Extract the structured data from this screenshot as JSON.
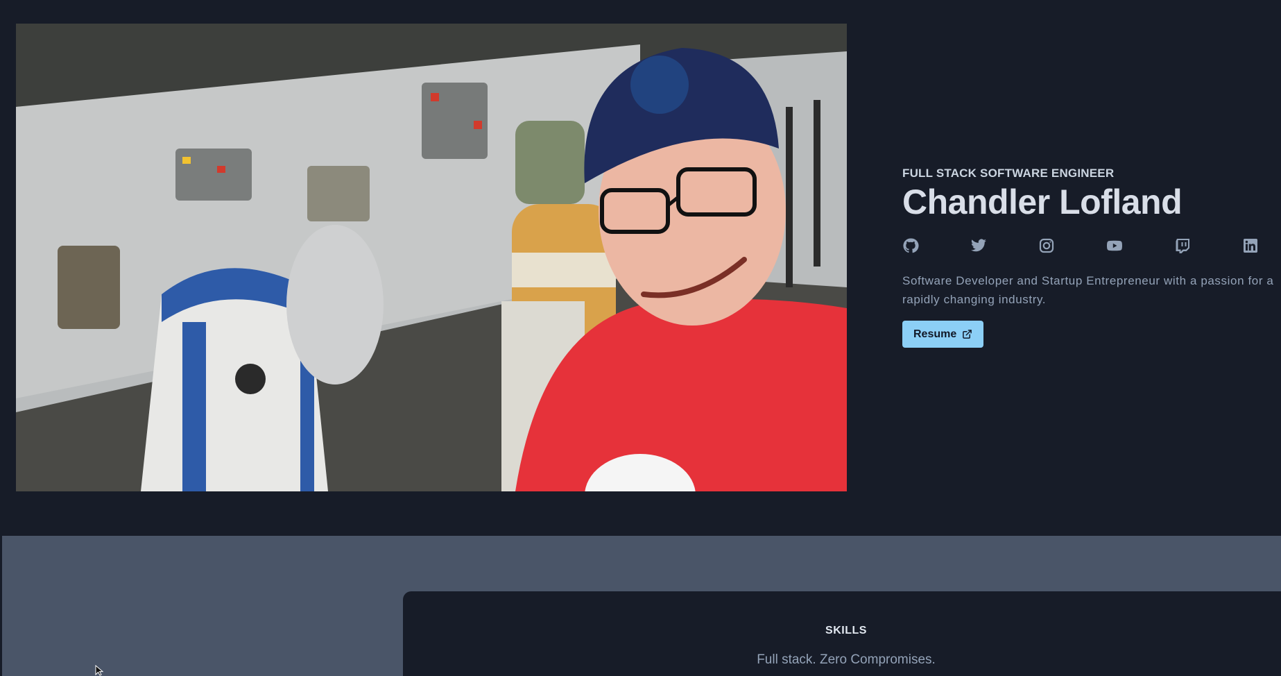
{
  "hero": {
    "role": "FULL STACK SOFTWARE ENGINEER",
    "name": "Chandler Lofland",
    "bio": "Software Developer and Startup Entrepreneur with a passion for a rapidly changing industry.",
    "resume_label": "Resume"
  },
  "socials": [
    {
      "name": "github-icon"
    },
    {
      "name": "twitter-icon"
    },
    {
      "name": "instagram-icon"
    },
    {
      "name": "youtube-icon"
    },
    {
      "name": "twitch-icon"
    },
    {
      "name": "linkedin-icon"
    }
  ],
  "skills": {
    "title": "SKILLS",
    "subtitle": "Full stack. Zero Compromises."
  },
  "colors": {
    "background": "#171c28",
    "accent": "#8ccff6",
    "band": "#4a5568"
  }
}
